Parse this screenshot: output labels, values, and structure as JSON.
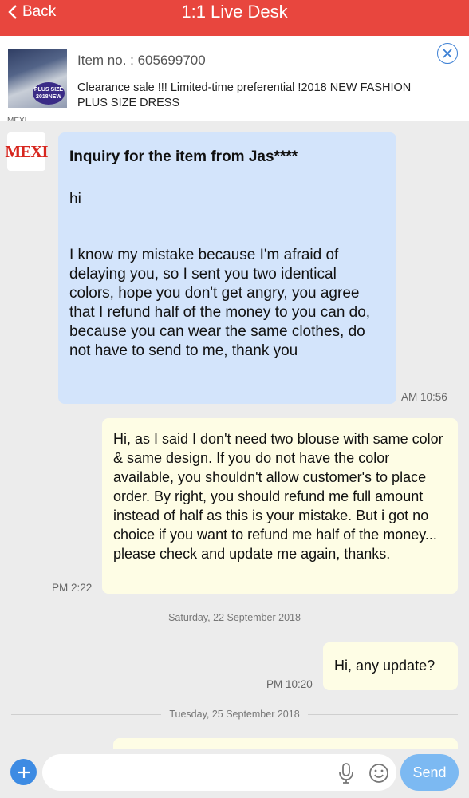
{
  "header": {
    "back_label": "Back",
    "title": "1:1 Live Desk"
  },
  "item": {
    "number": "Item no. : 605699700",
    "title": "Clearance sale !!! Limited-time preferential !2018 NEW FASHION PLUS SIZE DRESS",
    "thumb_badge": "PLUS SIZE 2018NEW"
  },
  "seller": {
    "name_cut": "MEXI",
    "avatar_text": "MEXI"
  },
  "messages": [
    {
      "inquiry_title": "Inquiry for the item from Jas****",
      "greeting": "hi",
      "body": "I know my mistake because I'm afraid of delaying you, so I sent you two identical colors, hope you don't get angry, you agree that I refund half of the money to you can do, because you can wear the same clothes, do not have to send to me, thank you",
      "time": "AM 10:56"
    },
    {
      "body": "Hi, as I said I don't need two blouse with same color & same design. If you do not have the color available, you shouldn't allow customer's to place order. By right, you should refund me full amount instead of half as this is your mistake. But i got no choice if you want to refund me half of the money... please check and update me again, thanks.",
      "time": "PM 2:22"
    },
    {
      "body": "Hi, any update?",
      "time": "PM 10:20"
    }
  ],
  "dates": {
    "d1": "Saturday, 22 September 2018",
    "d2": "Tuesday, 25 September 2018"
  },
  "composer": {
    "placeholder": "",
    "send_label": "Send"
  },
  "colors": {
    "header": "#e8463e",
    "seller_bubble": "#d3e4fb",
    "buyer_bubble": "#fefde5",
    "send_button": "#7cb9f2"
  },
  "icons": [
    "chevron-left-icon",
    "close-icon",
    "plus-icon",
    "mic-icon",
    "emoji-icon"
  ]
}
